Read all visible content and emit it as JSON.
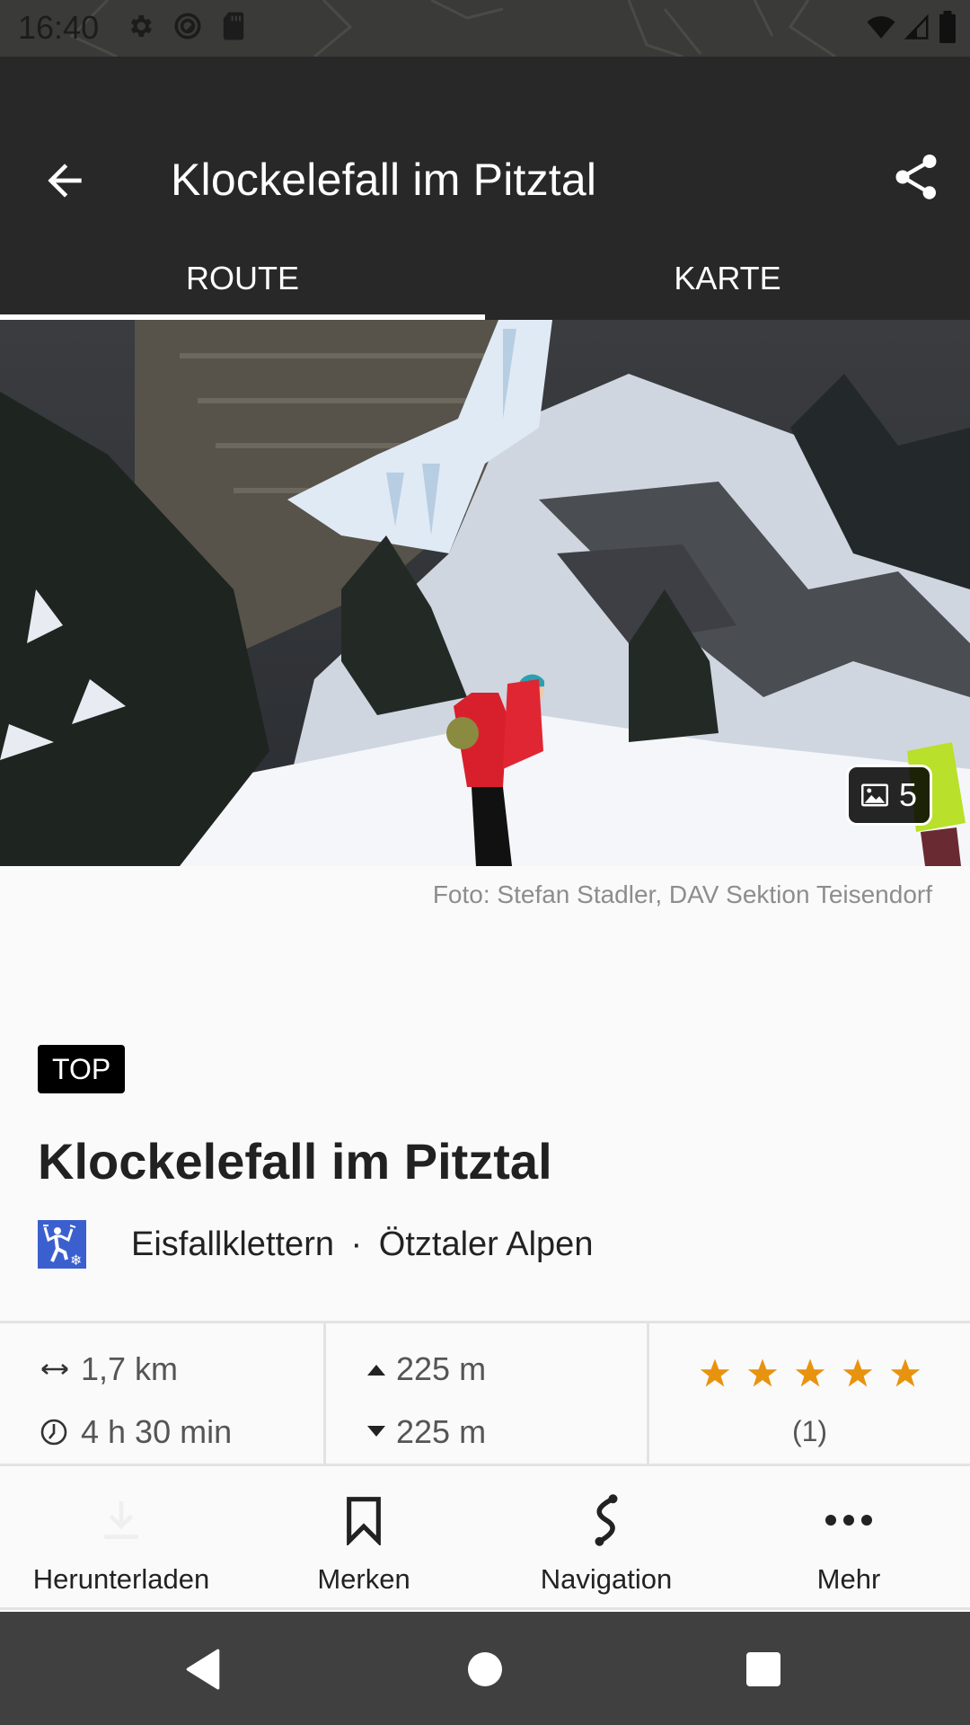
{
  "status_bar": {
    "time": "16:40",
    "left_icons": [
      "settings-icon",
      "sync-icon",
      "sd-card-icon"
    ],
    "right_icons": [
      "wifi-icon",
      "signal-icon",
      "battery-icon"
    ]
  },
  "app_bar": {
    "title": "Klockelefall im Pitztal",
    "back_icon": "arrow-back-icon",
    "share_icon": "share-icon"
  },
  "tabs": [
    {
      "label": "ROUTE",
      "active": true
    },
    {
      "label": "KARTE",
      "active": false
    }
  ],
  "hero": {
    "photo_count": "5",
    "photo_credit": "Foto: Stefan Stadler, DAV Sektion Teisendorf"
  },
  "route": {
    "badge": "TOP",
    "title": "Klockelefall im Pitztal",
    "category": "Eisfallklettern",
    "separator": "·",
    "region": "Ötztaler Alpen",
    "category_icon": "ice-climbing-icon"
  },
  "stats": {
    "distance": "1,7 km",
    "duration": "4 h 30 min",
    "ascent": "225 m",
    "descent": "225 m",
    "rating": 5,
    "rating_max": 5,
    "rating_count": "(1)",
    "star_color": "#e8930f"
  },
  "actions": [
    {
      "label": "Herunterladen",
      "icon": "download-icon",
      "enabled": false
    },
    {
      "label": "Merken",
      "icon": "bookmark-icon",
      "enabled": true
    },
    {
      "label": "Navigation",
      "icon": "route-icon",
      "enabled": true
    },
    {
      "label": "Mehr",
      "icon": "more-horizontal-icon",
      "enabled": true
    }
  ],
  "nav_bar": {
    "buttons": [
      "nav-back-icon",
      "nav-home-icon",
      "nav-recents-icon"
    ]
  }
}
